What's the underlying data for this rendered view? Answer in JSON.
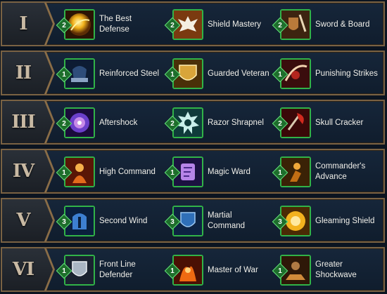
{
  "tiers": [
    {
      "rank": "I",
      "talents": [
        {
          "name": "The Best Defense",
          "points": "2",
          "icon": "golden-orb-icon"
        },
        {
          "name": "Shield Mastery",
          "points": "2",
          "icon": "eagle-crest-icon"
        },
        {
          "name": "Sword & Board",
          "points": "2",
          "icon": "sword-shield-icon"
        }
      ]
    },
    {
      "rank": "II",
      "talents": [
        {
          "name": "Reinforced Steel",
          "points": "1",
          "icon": "armor-helm-icon"
        },
        {
          "name": "Guarded Veteran",
          "points": "1",
          "icon": "golden-shield-icon"
        },
        {
          "name": "Punishing Strikes",
          "points": "1",
          "icon": "slash-strike-icon"
        }
      ]
    },
    {
      "rank": "III",
      "talents": [
        {
          "name": "Aftershock",
          "points": "2",
          "icon": "vortex-icon"
        },
        {
          "name": "Razor Shrapnel",
          "points": "2",
          "icon": "sawblade-icon"
        },
        {
          "name": "Skull Cracker",
          "points": "2",
          "icon": "red-axe-icon"
        }
      ]
    },
    {
      "rank": "IV",
      "talents": [
        {
          "name": "High Command",
          "points": "1",
          "icon": "flaming-warrior-icon"
        },
        {
          "name": "Magic Ward",
          "points": "1",
          "icon": "magic-scroll-icon"
        },
        {
          "name": "Commander's Advance",
          "points": "1",
          "icon": "marching-warrior-icon"
        }
      ]
    },
    {
      "rank": "V",
      "talents": [
        {
          "name": "Second Wind",
          "points": "3",
          "icon": "blue-helm-icon"
        },
        {
          "name": "Martial Command",
          "points": "3",
          "icon": "blue-shield-icon"
        },
        {
          "name": "Gleaming Shield",
          "points": "3",
          "icon": "sun-shield-icon"
        }
      ]
    },
    {
      "rank": "VI",
      "talents": [
        {
          "name": "Front Line Defender",
          "points": "1",
          "icon": "silver-shield-icon"
        },
        {
          "name": "Master of War",
          "points": "1",
          "icon": "fire-warrior-icon"
        },
        {
          "name": "Greater Shockwave",
          "points": "1",
          "icon": "ground-slam-icon"
        }
      ]
    }
  ],
  "colors": {
    "frame": "#7a6243",
    "badge": "#1e6e2c",
    "icon_border": "#31b348",
    "text": "#f0efe9"
  }
}
